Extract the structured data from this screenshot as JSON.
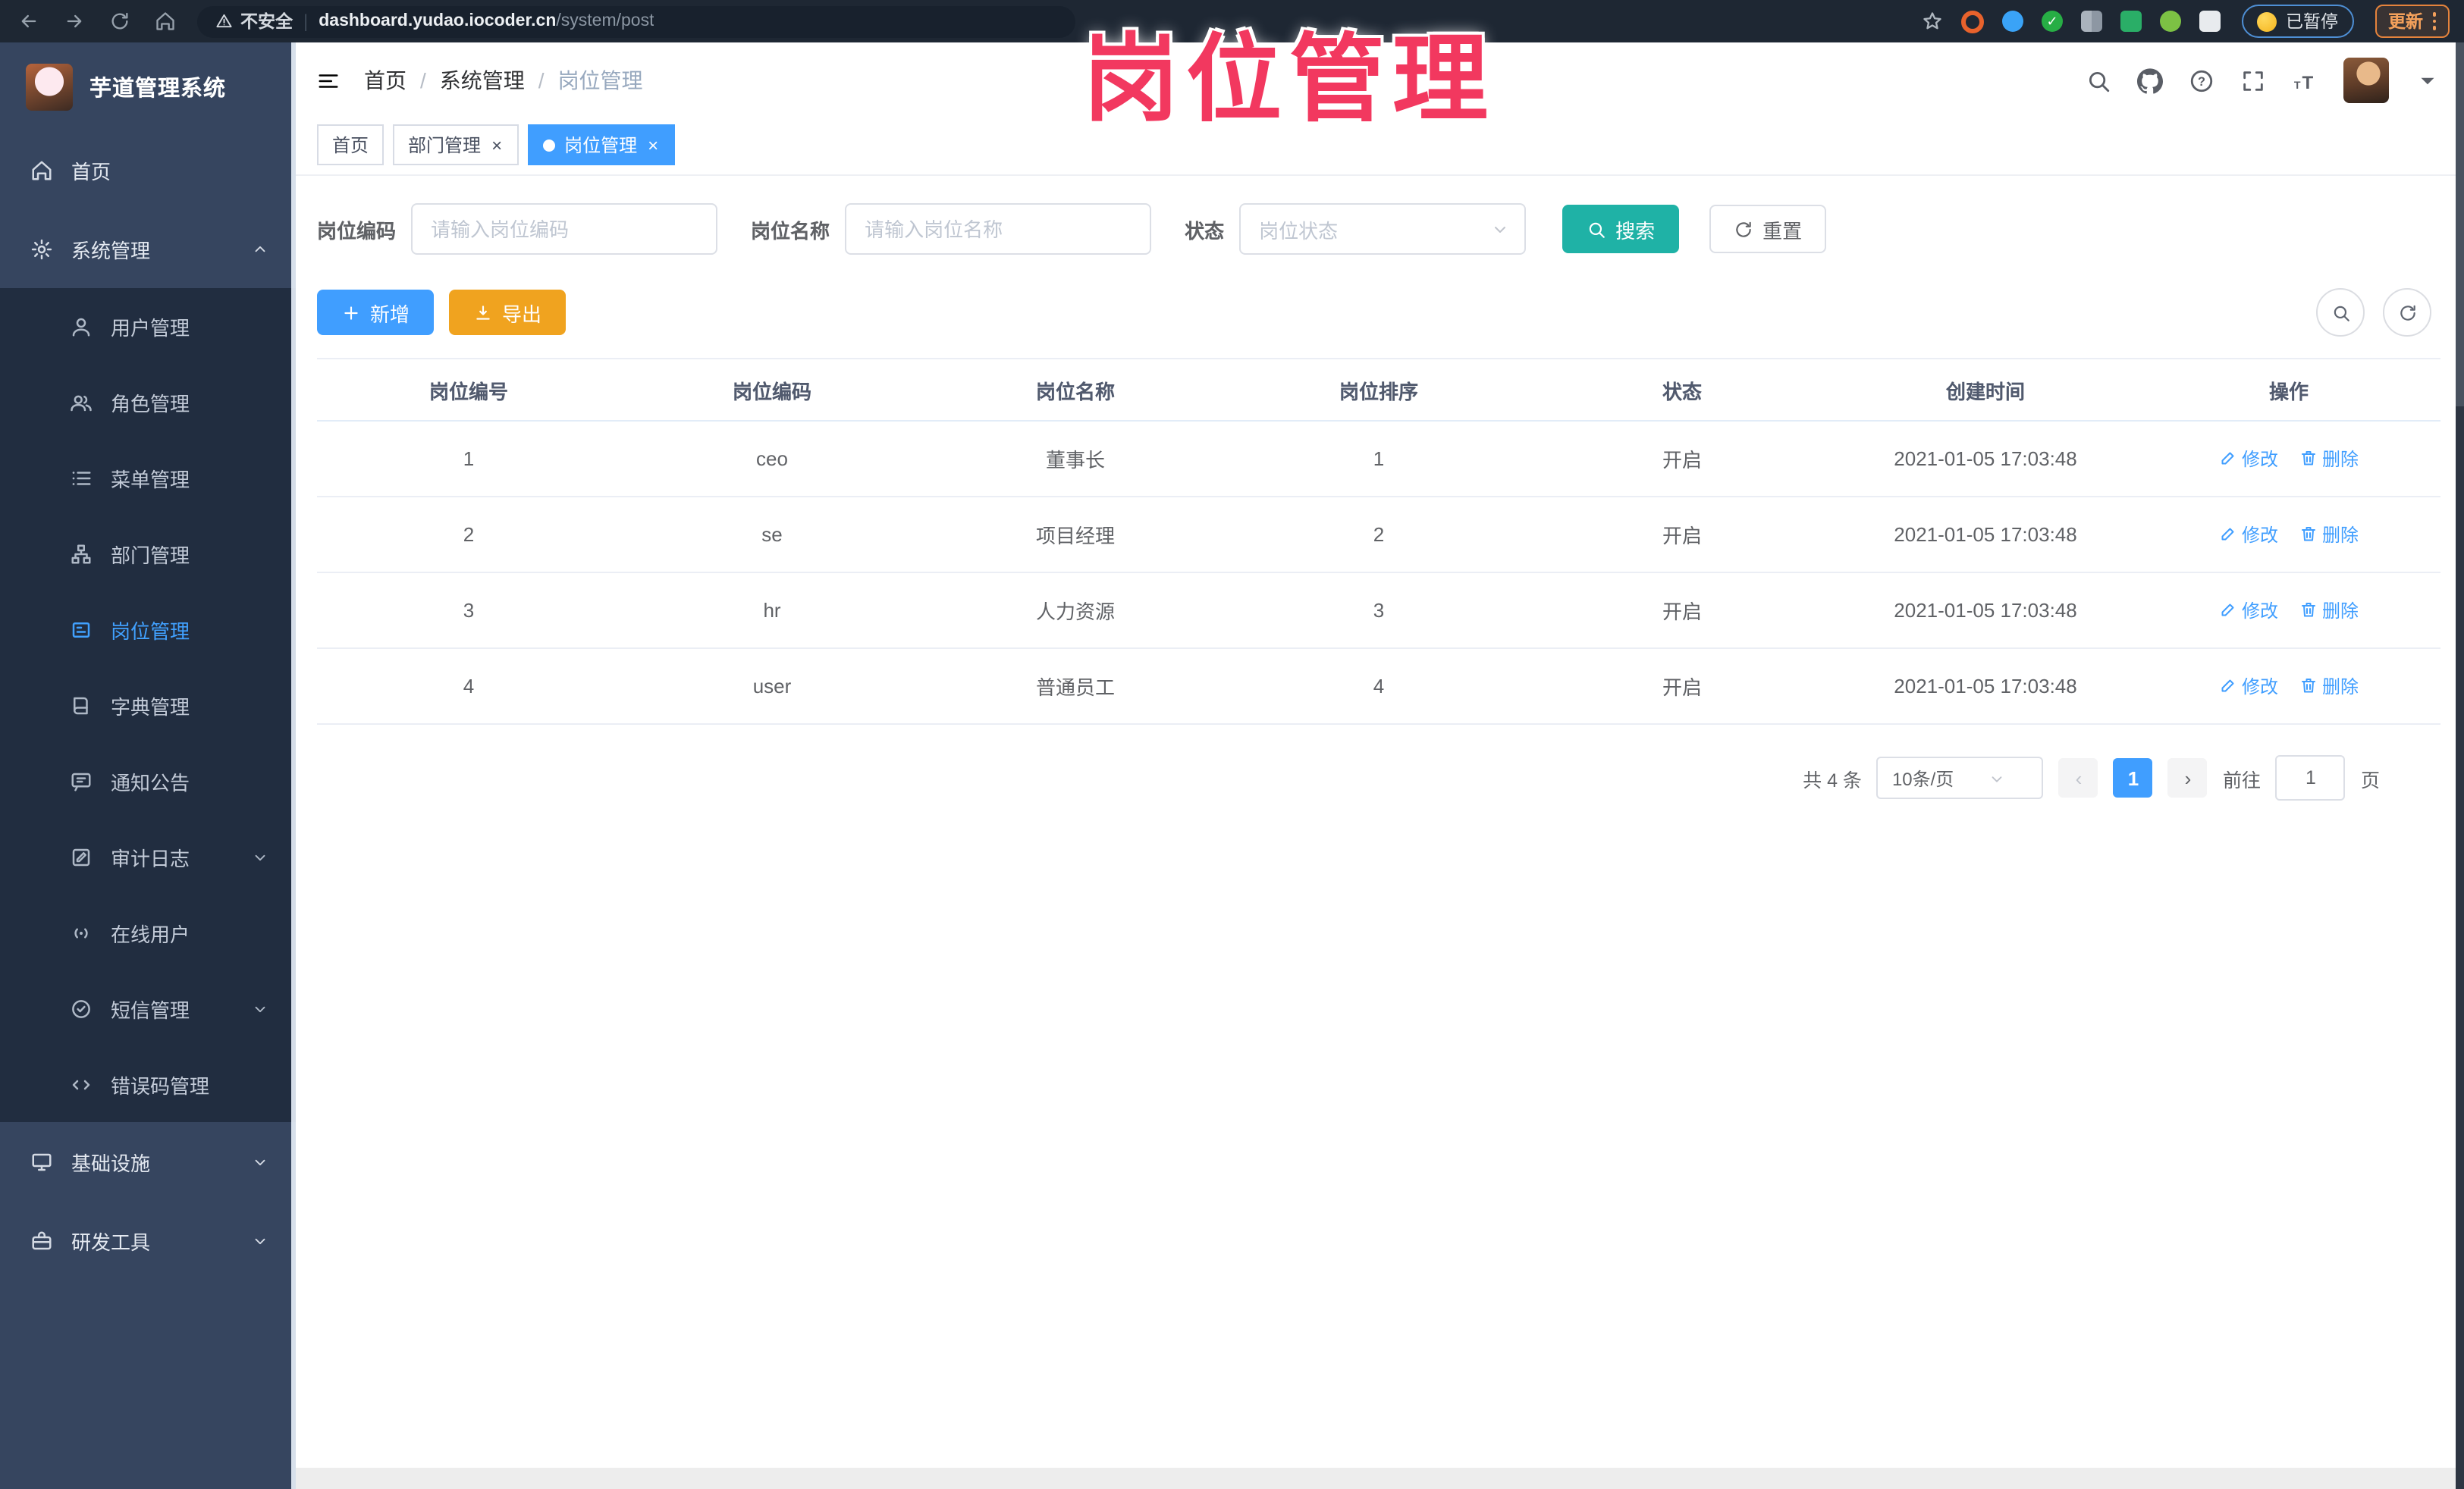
{
  "browser": {
    "security_label": "不安全",
    "url_domain": "dashboard.yudao.iocoder.cn",
    "url_path": "/system/post",
    "paused_label": "已暂停",
    "update_label": "更新"
  },
  "overlay_title": "岗位管理",
  "sidebar": {
    "title": "芋道管理系统",
    "items": [
      {
        "key": "home",
        "label": "首页",
        "icon": "home-icon",
        "level": "top",
        "active": false,
        "chevron": ""
      },
      {
        "key": "system",
        "label": "系统管理",
        "icon": "gear-icon",
        "level": "top",
        "active": false,
        "chevron": "up"
      },
      {
        "key": "user-mgmt",
        "label": "用户管理",
        "icon": "user-icon",
        "level": "sub",
        "active": false,
        "chevron": ""
      },
      {
        "key": "role-mgmt",
        "label": "角色管理",
        "icon": "users-icon",
        "level": "sub",
        "active": false,
        "chevron": ""
      },
      {
        "key": "menu-mgmt",
        "label": "菜单管理",
        "icon": "menu-list-icon",
        "level": "sub",
        "active": false,
        "chevron": ""
      },
      {
        "key": "dept-mgmt",
        "label": "部门管理",
        "icon": "org-tree-icon",
        "level": "sub",
        "active": false,
        "chevron": ""
      },
      {
        "key": "post-mgmt",
        "label": "岗位管理",
        "icon": "post-icon",
        "level": "sub",
        "active": true,
        "chevron": ""
      },
      {
        "key": "dict-mgmt",
        "label": "字典管理",
        "icon": "book-icon",
        "level": "sub",
        "active": false,
        "chevron": ""
      },
      {
        "key": "notice",
        "label": "通知公告",
        "icon": "comment-icon",
        "level": "sub",
        "active": false,
        "chevron": ""
      },
      {
        "key": "audit-log",
        "label": "审计日志",
        "icon": "edit-note-icon",
        "level": "sub",
        "active": false,
        "chevron": "down"
      },
      {
        "key": "online-users",
        "label": "在线用户",
        "icon": "online-icon",
        "level": "sub",
        "active": false,
        "chevron": ""
      },
      {
        "key": "sms-mgmt",
        "label": "短信管理",
        "icon": "message-icon",
        "level": "sub",
        "active": false,
        "chevron": "down"
      },
      {
        "key": "error-code",
        "label": "错误码管理",
        "icon": "code-icon",
        "level": "sub",
        "active": false,
        "chevron": ""
      },
      {
        "key": "infra",
        "label": "基础设施",
        "icon": "monitor-icon",
        "level": "top",
        "active": false,
        "chevron": "down"
      },
      {
        "key": "dev-tools",
        "label": "研发工具",
        "icon": "tool-icon",
        "level": "top",
        "active": false,
        "chevron": "down"
      }
    ]
  },
  "header": {
    "breadcrumb": [
      "首页",
      "系统管理",
      "岗位管理"
    ]
  },
  "tabs": [
    {
      "key": "home",
      "label": "首页",
      "closable": false,
      "active": false
    },
    {
      "key": "dept",
      "label": "部门管理",
      "closable": true,
      "active": false
    },
    {
      "key": "post",
      "label": "岗位管理",
      "closable": true,
      "active": true
    }
  ],
  "filter": {
    "code_label": "岗位编码",
    "code_placeholder": "请输入岗位编码",
    "name_label": "岗位名称",
    "name_placeholder": "请输入岗位名称",
    "status_label": "状态",
    "status_placeholder": "岗位状态",
    "search_label": "搜索",
    "reset_label": "重置"
  },
  "toolbar": {
    "add_label": "新增",
    "export_label": "导出"
  },
  "table": {
    "headers": [
      "岗位编号",
      "岗位编码",
      "岗位名称",
      "岗位排序",
      "状态",
      "创建时间",
      "操作"
    ],
    "rows": [
      {
        "id": "1",
        "code": "ceo",
        "name": "董事长",
        "sort": "1",
        "status": "开启",
        "created": "2021-01-05 17:03:48"
      },
      {
        "id": "2",
        "code": "se",
        "name": "项目经理",
        "sort": "2",
        "status": "开启",
        "created": "2021-01-05 17:03:48"
      },
      {
        "id": "3",
        "code": "hr",
        "name": "人力资源",
        "sort": "3",
        "status": "开启",
        "created": "2021-01-05 17:03:48"
      },
      {
        "id": "4",
        "code": "user",
        "name": "普通员工",
        "sort": "4",
        "status": "开启",
        "created": "2021-01-05 17:03:48"
      }
    ],
    "edit_label": "修改",
    "delete_label": "删除"
  },
  "pagination": {
    "total": "共 4 条",
    "page_size": "10条/页",
    "prev": "‹",
    "current": "1",
    "next": "›",
    "goto_label": "前往",
    "goto_value": "1",
    "unit_label": "页"
  },
  "colors": {
    "accent": "#409eff",
    "search_teal": "#1fb2a6",
    "export_amber": "#f0a31f",
    "overlay_red": "#f2385f",
    "sidebar_bg": "#36455f",
    "submenu_bg": "#212d40"
  }
}
